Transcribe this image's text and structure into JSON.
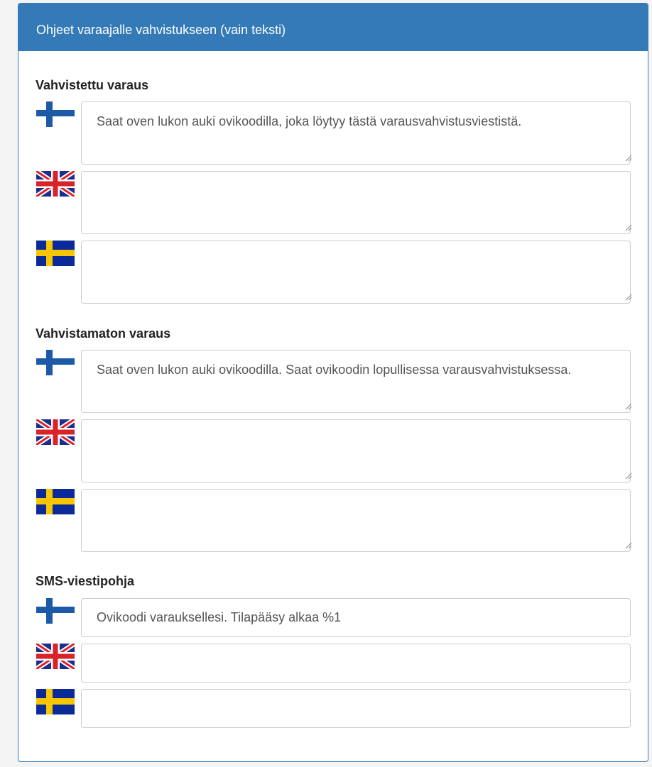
{
  "panel": {
    "title": "Ohjeet varaajalle vahvistukseen (vain teksti)"
  },
  "sections": [
    {
      "title": "Vahvistettu varaus",
      "fields": [
        {
          "lang": "fi",
          "flag_icon": "finland-flag-icon",
          "value": "Saat oven lukon auki ovikoodilla, joka löytyy tästä varausvahvistusviestistä."
        },
        {
          "lang": "en",
          "flag_icon": "uk-flag-icon",
          "value": ""
        },
        {
          "lang": "sv",
          "flag_icon": "sweden-flag-icon",
          "value": ""
        }
      ]
    },
    {
      "title": "Vahvistamaton varaus",
      "fields": [
        {
          "lang": "fi",
          "flag_icon": "finland-flag-icon",
          "value": "Saat oven lukon auki ovikoodilla. Saat ovikoodin lopullisessa varausvahvistuksessa."
        },
        {
          "lang": "en",
          "flag_icon": "uk-flag-icon",
          "value": ""
        },
        {
          "lang": "sv",
          "flag_icon": "sweden-flag-icon",
          "value": ""
        }
      ]
    },
    {
      "title": "SMS-viestipohja",
      "fields": [
        {
          "lang": "fi",
          "flag_icon": "finland-flag-icon",
          "value": "Ovikoodi varauksellesi. Tilapääsy alkaa %1"
        },
        {
          "lang": "en",
          "flag_icon": "uk-flag-icon",
          "value": ""
        },
        {
          "lang": "sv",
          "flag_icon": "sweden-flag-icon",
          "value": ""
        }
      ]
    }
  ],
  "colors": {
    "accent": "#337ab7",
    "finland_blue": "#1c5aa8",
    "uk_blue": "#1c2d8f",
    "uk_red": "#d8232a",
    "sweden_blue": "#0a2a9a",
    "sweden_yellow": "#f7c600"
  }
}
